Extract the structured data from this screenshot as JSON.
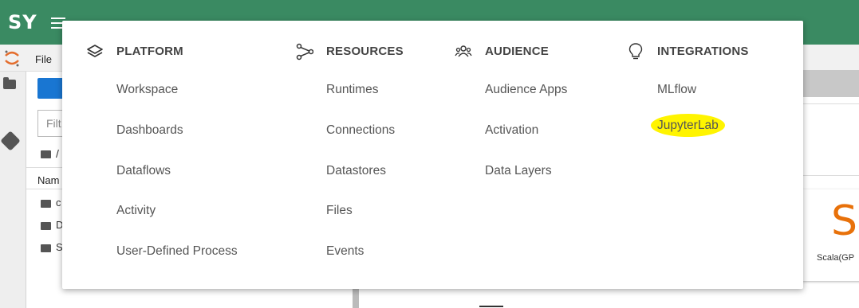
{
  "header": {
    "brand": "SY"
  },
  "menubar": {
    "file_label": "File"
  },
  "file_browser": {
    "filter_placeholder": "Filt",
    "path": "/",
    "column_name": "Nam",
    "rows": [
      "c",
      "D",
      "S"
    ]
  },
  "launcher": {
    "kernel_logo": "S",
    "kernel_label": "Scala(GP"
  },
  "menu": {
    "platform": {
      "title": "PLATFORM",
      "icon": "layers-icon",
      "items": [
        "Workspace",
        "Dashboards",
        "Dataflows",
        "Activity",
        "User-Defined Process"
      ]
    },
    "resources": {
      "title": "RESOURCES",
      "icon": "share-nodes-icon",
      "items": [
        "Runtimes",
        "Connections",
        "Datastores",
        "Files",
        "Events"
      ]
    },
    "audience": {
      "title": "AUDIENCE",
      "icon": "people-icon",
      "items": [
        "Audience Apps",
        "Activation",
        "Data Layers"
      ]
    },
    "integrations": {
      "title": "INTEGRATIONS",
      "icon": "lightbulb-icon",
      "items": [
        "MLflow",
        "JupyterLab"
      ],
      "highlight_color": "#fff400"
    }
  },
  "colors": {
    "header": "#3a8a62",
    "accent_button": "#1976d2",
    "kernel_orange": "#e8710a"
  }
}
